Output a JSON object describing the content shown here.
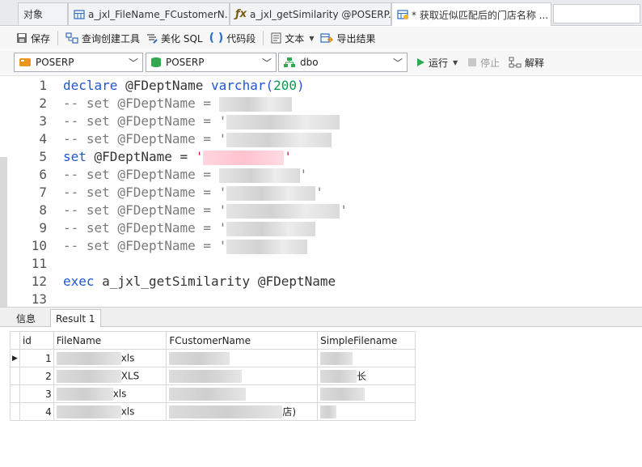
{
  "tabs": [
    {
      "label": "对象",
      "icon": "none"
    },
    {
      "label": "a_jxl_FileName_FCustomerN...",
      "icon": "table-icon"
    },
    {
      "label": "a_jxl_getSimilarity @POSERP...",
      "icon": "function-icon"
    },
    {
      "label": "* 获取近似匹配后的门店名称 ...",
      "icon": "query-icon"
    }
  ],
  "toolbar": {
    "save": "保存",
    "query_builder": "查询创建工具",
    "beautify": "美化 SQL",
    "snippet": "代码段",
    "text": "文本",
    "export": "导出结果"
  },
  "connection": {
    "conn_value": "POSERP",
    "db_value": "POSERP",
    "schema_value": "dbo",
    "run": "运行",
    "stop": "停止",
    "explain": "解释"
  },
  "editor": {
    "lines": [
      {
        "n": "1",
        "parts": [
          [
            "kw",
            "declare"
          ],
          [
            "var",
            " @FDeptName "
          ],
          [
            "kw",
            "varchar("
          ],
          [
            "num",
            "200"
          ],
          [
            "kw",
            ")"
          ]
        ]
      },
      {
        "n": "2",
        "parts": [
          [
            "cm",
            "-- set @FDeptName = "
          ]
        ],
        "mask": 90
      },
      {
        "n": "3",
        "parts": [
          [
            "cm",
            "-- set @FDeptName = '"
          ]
        ],
        "mask": 140
      },
      {
        "n": "4",
        "parts": [
          [
            "cm",
            "-- set @FDeptName = '"
          ]
        ],
        "mask": 130
      },
      {
        "n": "5",
        "parts": [
          [
            "kw",
            "set"
          ],
          [
            "var",
            " @FDeptName = "
          ],
          [
            "str",
            "'"
          ]
        ],
        "mask": 100,
        "mask_pink": true,
        "tail": "'"
      },
      {
        "n": "6",
        "parts": [
          [
            "cm",
            "-- set @FDeptName = "
          ]
        ],
        "mask": 100,
        "tail": "'"
      },
      {
        "n": "7",
        "parts": [
          [
            "cm",
            "-- set @FDeptName = '"
          ]
        ],
        "mask": 110,
        "tail": "'"
      },
      {
        "n": "8",
        "parts": [
          [
            "cm",
            "-- set @FDeptName = '"
          ]
        ],
        "mask": 140,
        "tail": "'"
      },
      {
        "n": "9",
        "parts": [
          [
            "cm",
            "-- set @FDeptName = '"
          ]
        ],
        "mask": 110
      },
      {
        "n": "10",
        "parts": [
          [
            "cm",
            "-- set @FDeptName = '"
          ]
        ],
        "mask": 100
      },
      {
        "n": "11",
        "parts": []
      },
      {
        "n": "12",
        "parts": [
          [
            "kw",
            "exec"
          ],
          [
            "var",
            " a_jxl_getSimilarity @FDeptName"
          ]
        ]
      },
      {
        "n": "13",
        "parts": []
      }
    ]
  },
  "results": {
    "tabs": [
      "信息",
      "Result 1"
    ],
    "columns": [
      "id",
      "FileName",
      "FCustomerName",
      "SimpleFilename"
    ],
    "rows": [
      {
        "id": "1",
        "file_suffix": "xls",
        "cust_suffix": "",
        "simple_suffix": "",
        "selected": true
      },
      {
        "id": "2",
        "file_suffix": "XLS",
        "cust_suffix": "",
        "simple_suffix": "长",
        "selected": false
      },
      {
        "id": "3",
        "file_suffix": "xls",
        "cust_suffix": "",
        "simple_suffix": "",
        "selected": false
      },
      {
        "id": "4",
        "file_suffix": "xls",
        "cust_suffix": "店)",
        "simple_suffix": "",
        "selected": false
      }
    ]
  }
}
